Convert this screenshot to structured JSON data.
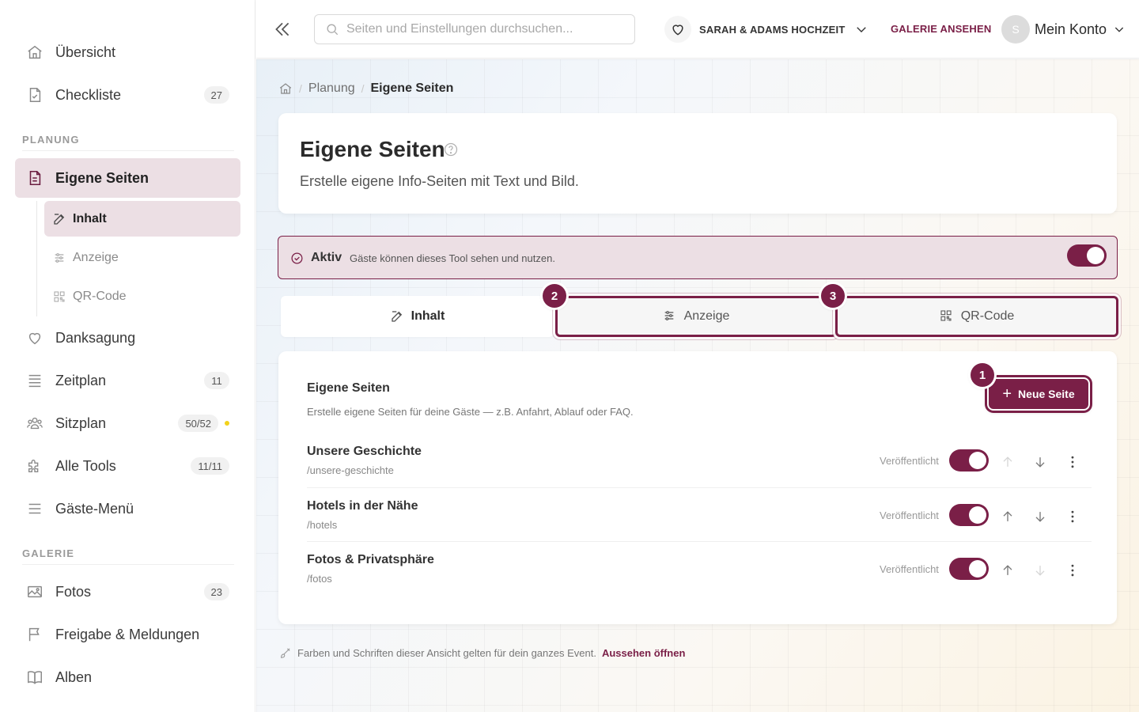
{
  "sidebar": {
    "items": [
      {
        "label": "Übersicht",
        "icon": "home-icon"
      },
      {
        "label": "Checkliste",
        "badge": "27",
        "icon": "checklist-icon"
      }
    ],
    "planung_label": "PLANUNG",
    "planung_items": [
      {
        "label": "Eigene Seiten",
        "icon": "document-icon"
      },
      {
        "label": "Danksagung",
        "icon": "heart-icon"
      },
      {
        "label": "Zeitplan",
        "badge": "11",
        "icon": "list-icon"
      },
      {
        "label": "Sitzplan",
        "badge": "50/52",
        "icon": "people-icon"
      },
      {
        "label": "Alle Tools",
        "badge": "11/11",
        "icon": "puzzle-icon"
      },
      {
        "label": "Gäste-Menü",
        "icon": "menu-icon"
      }
    ],
    "sub_items": [
      {
        "label": "Inhalt",
        "icon": "edit-icon"
      },
      {
        "label": "Anzeige",
        "icon": "sliders-icon"
      },
      {
        "label": "QR-Code",
        "icon": "qr-icon"
      }
    ],
    "galerie_label": "GALERIE",
    "galerie_items": [
      {
        "label": "Fotos",
        "badge": "23",
        "icon": "image-icon"
      },
      {
        "label": "Freigabe & Meldungen",
        "icon": "flag-icon"
      },
      {
        "label": "Alben",
        "icon": "book-icon"
      }
    ]
  },
  "topbar": {
    "search_placeholder": "Seiten und Einstellungen durchsuchen...",
    "event_name": "SARAH & ADAMS HOCHZEIT",
    "gallery_link": "GALERIE ANSEHEN",
    "avatar_initial": "S",
    "account_label": "Mein Konto"
  },
  "breadcrumb": {
    "parent": "Planung",
    "current": "Eigene Seiten"
  },
  "header": {
    "title": "Eigene Seiten",
    "description": "Erstelle eigene Info-Seiten mit Text und Bild."
  },
  "status": {
    "label": "Aktiv",
    "text": "Gäste können dieses Tool sehen und nutzen."
  },
  "tabs": [
    {
      "label": "Inhalt",
      "step": ""
    },
    {
      "label": "Anzeige",
      "step": "2"
    },
    {
      "label": "QR-Code",
      "step": "3"
    }
  ],
  "content": {
    "title": "Eigene Seiten",
    "description": "Erstelle eigene Seiten für deine Gäste — z.B. Anfahrt, Ablauf oder FAQ.",
    "new_button": "Neue Seite",
    "new_button_step": "1",
    "status_label": "Veröffentlicht",
    "pages": [
      {
        "title": "Unsere Geschichte",
        "path": "/unsere-geschichte"
      },
      {
        "title": "Hotels in der Nähe",
        "path": "/hotels"
      },
      {
        "title": "Fotos & Privatsphäre",
        "path": "/fotos"
      }
    ]
  },
  "footer": {
    "text": "Farben und Schriften dieser Ansicht gelten für dein ganzes Event.",
    "link": "Aussehen öffnen"
  },
  "colors": {
    "accent": "#7a1f47",
    "active_bg": "#ecdfe4",
    "dot": "#f2d21b"
  }
}
